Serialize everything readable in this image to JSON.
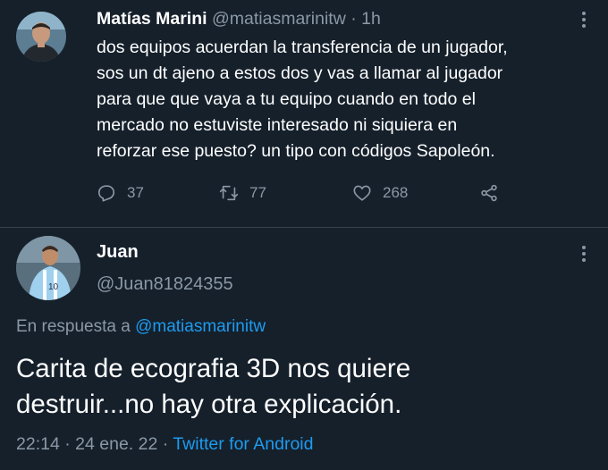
{
  "tweet": {
    "author_name": "Matías Marini",
    "author_handle": "@matiasmarinitw",
    "separator": "·",
    "time": "1h",
    "body_lines": [
      "dos equipos acuerdan la transferencia de un jugador,",
      "sos un dt ajeno a estos dos y vas a llamar al jugador",
      "para que que vaya a tu equipo cuando en todo el",
      "mercado no estuviste interesado ni siquiera en",
      "reforzar ese puesto? un tipo con códigos Sapoleón."
    ],
    "reply_count": "37",
    "retweet_count": "77",
    "like_count": "268",
    "icons": {
      "reply": "reply-icon",
      "retweet": "retweet-icon",
      "like": "heart-icon",
      "share": "share-icon",
      "more": "more-icon"
    }
  },
  "reply": {
    "author_name": "Juan",
    "author_handle": "@Juan81824355",
    "replying_prefix": "En respuesta a",
    "replying_to": "@matiasmarinitw",
    "body_lines": [
      "Carita de ecografia 3D nos quiere",
      "destruir...no hay otra explicación."
    ],
    "time": "22:14",
    "separator": "·",
    "date": "24 ene. 22",
    "source": "Twitter for Android"
  },
  "colors": {
    "background": "#15202b",
    "text": "#ffffff",
    "secondary": "#8b98a5",
    "link": "#1d9bf0",
    "divider": "#38444d"
  }
}
